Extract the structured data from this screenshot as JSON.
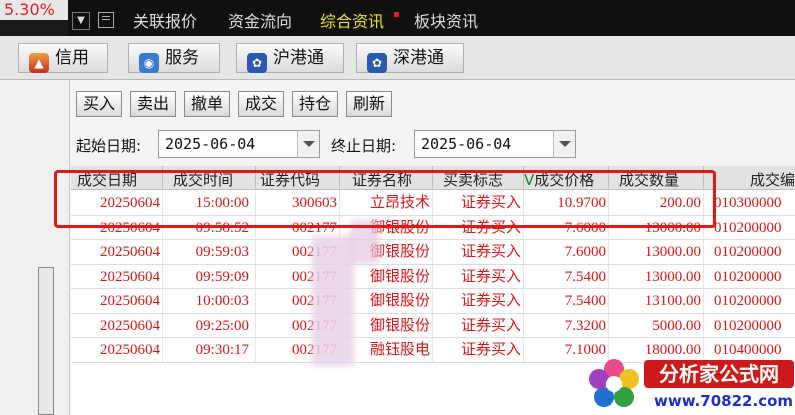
{
  "topbar": {
    "percent": "5.30%",
    "tabs": [
      "关联报价",
      "资金流向",
      "综合资讯",
      "板块资讯"
    ],
    "active_tab": "综合资讯"
  },
  "service_tabs": [
    {
      "label": "信用",
      "icon": "credit-icon"
    },
    {
      "label": "服务",
      "icon": "service-icon"
    },
    {
      "label": "沪港通",
      "icon": "hk-connect-icon"
    },
    {
      "label": "深港通",
      "icon": "sz-connect-icon"
    }
  ],
  "actions": [
    "买入",
    "卖出",
    "撤单",
    "成交",
    "持仓",
    "刷新"
  ],
  "filters": {
    "start_label": "起始日期:",
    "start_value": "2025-06-04",
    "end_label": "终止日期:",
    "end_value": "2025-06-04"
  },
  "table": {
    "columns": [
      "成交日期",
      "成交时间",
      "证券代码",
      "证券名称",
      "买卖标志",
      "成交价格",
      "成交数量",
      "成交编"
    ],
    "rows": [
      [
        "20250604",
        "15:00:00",
        "300603",
        "立昂技术",
        "证券买入",
        "10.9700",
        "200.00",
        "010300000"
      ],
      [
        "20250604",
        "09:58:52",
        "002177",
        "御银股份",
        "证券买入",
        "7.6000",
        "13000.00",
        "010200000"
      ],
      [
        "20250604",
        "09:59:03",
        "002177",
        "御银股份",
        "证券买入",
        "7.6000",
        "13000.00",
        "010200000"
      ],
      [
        "20250604",
        "09:59:09",
        "002177",
        "御银股份",
        "证券买入",
        "7.5400",
        "13000.00",
        "010200000"
      ],
      [
        "20250604",
        "10:00:03",
        "002177",
        "御银股份",
        "证券买入",
        "7.5400",
        "13100.00",
        "010200000"
      ],
      [
        "20250604",
        "09:25:00",
        "002177",
        "御银股份",
        "证券买入",
        "7.3200",
        "5000.00",
        "010200000"
      ],
      [
        "20250604",
        "09:30:17",
        "002177",
        "融钰股电",
        "证券买入",
        "7.1000",
        "18000.00",
        "010400000"
      ]
    ]
  },
  "watermark": {
    "title": "分析家公式网",
    "url": "www.70822.com"
  },
  "colors": {
    "accent_red": "#d81818",
    "active_tab_yellow": "#e8e020"
  }
}
